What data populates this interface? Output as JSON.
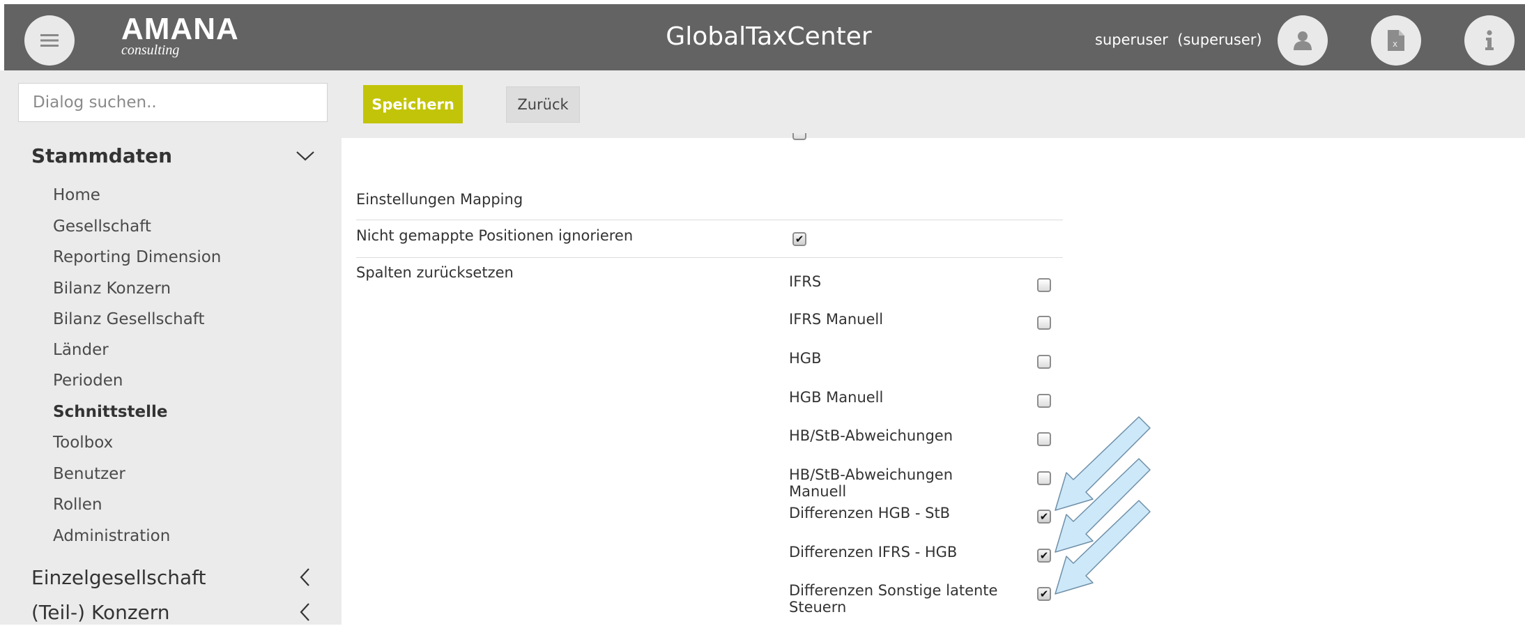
{
  "header": {
    "logo_main": "AMANA",
    "logo_sub": "consulting",
    "app_title": "GlobalTaxCenter",
    "user": "superuser  (superuser)",
    "bg_color": "#636363"
  },
  "search": {
    "placeholder": "Dialog suchen.."
  },
  "toolbar": {
    "save_label": "Speichern",
    "back_label": "Zurück",
    "save_color": "#c2c409"
  },
  "sidebar": {
    "section_stammdaten": "Stammdaten",
    "items": [
      {
        "label": "Home"
      },
      {
        "label": "Gesellschaft"
      },
      {
        "label": "Reporting Dimension"
      },
      {
        "label": "Bilanz Konzern"
      },
      {
        "label": "Bilanz Gesellschaft"
      },
      {
        "label": "Länder"
      },
      {
        "label": "Perioden"
      },
      {
        "label": "Schnittstelle",
        "active": true
      },
      {
        "label": "Toolbox"
      },
      {
        "label": "Benutzer"
      },
      {
        "label": "Rollen"
      },
      {
        "label": "Administration"
      }
    ],
    "section_einzel": "Einzelgesellschaft",
    "section_konzern": "(Teil-) Konzern"
  },
  "settings": {
    "section_title": "Einstellungen Mapping",
    "ignore_label": "Nicht gemappte Positionen ignorieren",
    "ignore_checked": true,
    "reset_label": "Spalten zurücksetzen",
    "columns": [
      {
        "label": "IFRS",
        "checked": false
      },
      {
        "label": "IFRS Manuell",
        "checked": false
      },
      {
        "label": "HGB",
        "checked": false
      },
      {
        "label": "HGB Manuell",
        "checked": false
      },
      {
        "label": "HB/StB-Abweichungen",
        "checked": false
      },
      {
        "label": "HB/StB-Abweichungen Manuell",
        "checked": false
      },
      {
        "label": "Differenzen HGB - StB",
        "checked": true
      },
      {
        "label": "Differenzen IFRS - HGB",
        "checked": true
      },
      {
        "label": "Differenzen Sonstige latente Steuern",
        "checked": true
      }
    ]
  },
  "icons": {
    "menu": "hamburger-icon",
    "user": "user-icon",
    "excel": "excel-file-icon",
    "info": "info-icon",
    "chevron_down": "chevron-down-icon",
    "chevron_left": "chevron-left-icon",
    "arrow": "annotation-arrow-icon"
  },
  "annotation_color": "#cde8f8"
}
